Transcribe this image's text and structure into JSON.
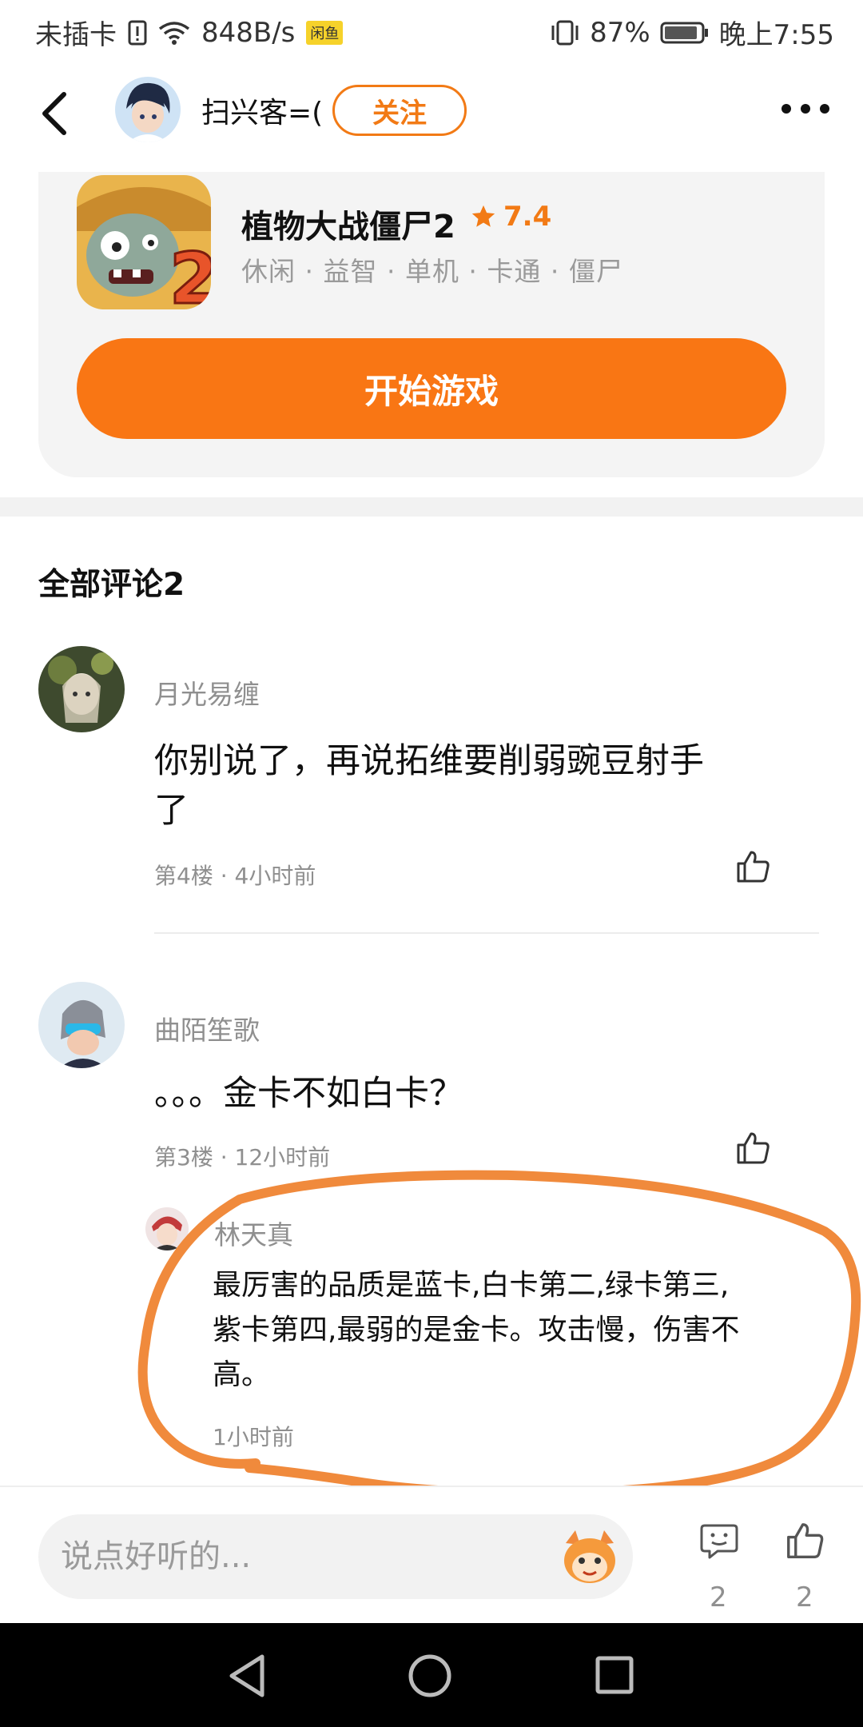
{
  "status_bar": {
    "carrier": "未插卡",
    "speed": "848B/s",
    "badge": "闲鱼",
    "battery": "87%",
    "time": "晚上7:55"
  },
  "header": {
    "username": "扫兴客=(",
    "follow_label": "关注"
  },
  "game": {
    "title": "植物大战僵尸2",
    "rating": "7.4",
    "tags": "休闲 · 益智 · 单机 · 卡通 · 僵尸",
    "play_label": "开始游戏"
  },
  "comments_section": {
    "title": "全部评论2",
    "comments": [
      {
        "name": "月光易缠",
        "text_line1": "你别说了，再说拓维要削弱豌豆射手",
        "text_line2": "了",
        "meta": "第4楼 · 4小时前"
      },
      {
        "name": "曲陌笙歌",
        "text": "。。。金卡不如白卡？",
        "meta": "第3楼 · 12小时前",
        "reply": {
          "name": "林天真",
          "line1": "最厉害的品质是蓝卡,白卡第二,绿卡第三,",
          "line2": "紫卡第四,最弱的是金卡。攻击慢，伤害不",
          "line3": "高。",
          "time": "1小时前"
        }
      }
    ]
  },
  "bottom_bar": {
    "input_placeholder": "说点好听的...",
    "comment_count": "2",
    "like_count": "2"
  },
  "colors": {
    "accent": "#f97614",
    "annotation": "#f08a3c"
  }
}
